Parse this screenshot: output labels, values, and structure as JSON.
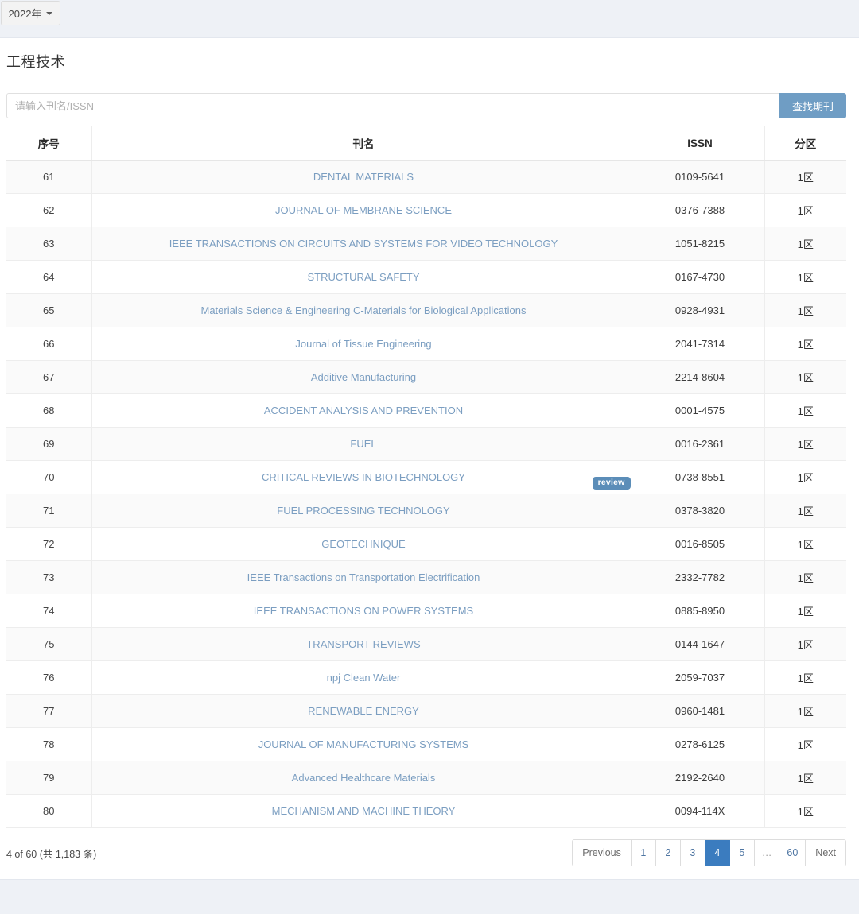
{
  "topbar": {
    "year_label": "2022年",
    "caret_icon": "chevron-down-icon"
  },
  "page": {
    "title": "工程技术"
  },
  "search": {
    "placeholder": "请输入刊名/ISSN",
    "value": "",
    "button_label": "查找期刊"
  },
  "table": {
    "headers": {
      "seq": "序号",
      "name": "刊名",
      "issn": "ISSN",
      "zone": "分区"
    },
    "rows": [
      {
        "seq": "61",
        "name": "DENTAL MATERIALS",
        "issn": "0109-5641",
        "zone": "1区",
        "badge": ""
      },
      {
        "seq": "62",
        "name": "JOURNAL OF MEMBRANE SCIENCE",
        "issn": "0376-7388",
        "zone": "1区",
        "badge": ""
      },
      {
        "seq": "63",
        "name": "IEEE TRANSACTIONS ON CIRCUITS AND SYSTEMS FOR VIDEO TECHNOLOGY",
        "issn": "1051-8215",
        "zone": "1区",
        "badge": ""
      },
      {
        "seq": "64",
        "name": "STRUCTURAL SAFETY",
        "issn": "0167-4730",
        "zone": "1区",
        "badge": ""
      },
      {
        "seq": "65",
        "name": "Materials Science & Engineering C-Materials for Biological Applications",
        "issn": "0928-4931",
        "zone": "1区",
        "badge": ""
      },
      {
        "seq": "66",
        "name": "Journal of Tissue Engineering",
        "issn": "2041-7314",
        "zone": "1区",
        "badge": ""
      },
      {
        "seq": "67",
        "name": "Additive Manufacturing",
        "issn": "2214-8604",
        "zone": "1区",
        "badge": ""
      },
      {
        "seq": "68",
        "name": "ACCIDENT ANALYSIS AND PREVENTION",
        "issn": "0001-4575",
        "zone": "1区",
        "badge": ""
      },
      {
        "seq": "69",
        "name": "FUEL",
        "issn": "0016-2361",
        "zone": "1区",
        "badge": ""
      },
      {
        "seq": "70",
        "name": "CRITICAL REVIEWS IN BIOTECHNOLOGY",
        "issn": "0738-8551",
        "zone": "1区",
        "badge": "review"
      },
      {
        "seq": "71",
        "name": "FUEL PROCESSING TECHNOLOGY",
        "issn": "0378-3820",
        "zone": "1区",
        "badge": ""
      },
      {
        "seq": "72",
        "name": "GEOTECHNIQUE",
        "issn": "0016-8505",
        "zone": "1区",
        "badge": ""
      },
      {
        "seq": "73",
        "name": "IEEE Transactions on Transportation Electrification",
        "issn": "2332-7782",
        "zone": "1区",
        "badge": ""
      },
      {
        "seq": "74",
        "name": "IEEE TRANSACTIONS ON POWER SYSTEMS",
        "issn": "0885-8950",
        "zone": "1区",
        "badge": ""
      },
      {
        "seq": "75",
        "name": "TRANSPORT REVIEWS",
        "issn": "0144-1647",
        "zone": "1区",
        "badge": ""
      },
      {
        "seq": "76",
        "name": "npj Clean Water",
        "issn": "2059-7037",
        "zone": "1区",
        "badge": ""
      },
      {
        "seq": "77",
        "name": "RENEWABLE ENERGY",
        "issn": "0960-1481",
        "zone": "1区",
        "badge": ""
      },
      {
        "seq": "78",
        "name": "JOURNAL OF MANUFACTURING SYSTEMS",
        "issn": "0278-6125",
        "zone": "1区",
        "badge": ""
      },
      {
        "seq": "79",
        "name": "Advanced Healthcare Materials",
        "issn": "2192-2640",
        "zone": "1区",
        "badge": ""
      },
      {
        "seq": "80",
        "name": "MECHANISM AND MACHINE THEORY",
        "issn": "0094-114X",
        "zone": "1区",
        "badge": ""
      }
    ]
  },
  "footer": {
    "count_text": "4 of 60 (共 1,183 条)",
    "pagination": {
      "previous_label": "Previous",
      "next_label": "Next",
      "pages": [
        "1",
        "2",
        "3",
        "4",
        "5",
        "…",
        "60"
      ],
      "active_page": "4"
    }
  },
  "colors": {
    "accent_blue": "#3b7cbf",
    "button_blue": "#6f9dc4",
    "badge_blue": "#5b8db8",
    "link_blue": "#7b9ec1",
    "page_bg": "#eef1f6"
  }
}
